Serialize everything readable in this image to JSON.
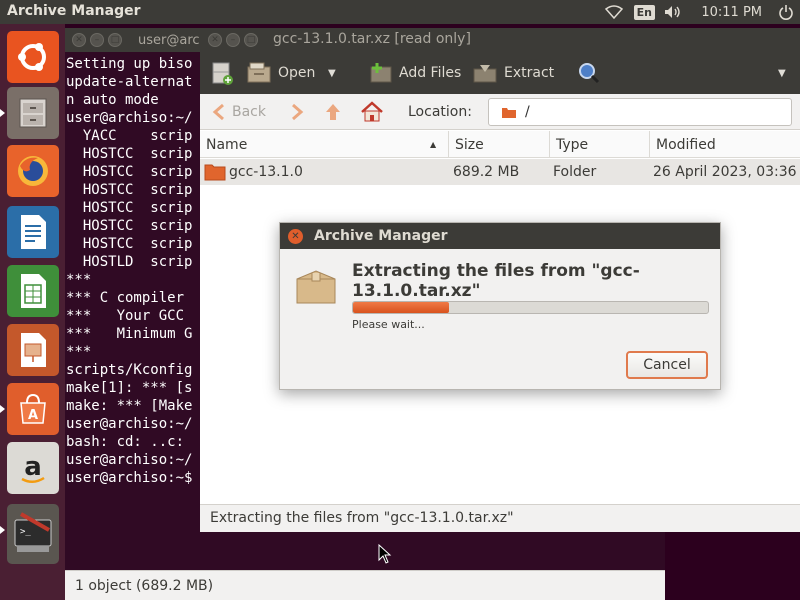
{
  "top_panel": {
    "app_title": "Archive Manager",
    "lang": "En",
    "clock": "10:11 PM",
    "icons": [
      "wifi-icon",
      "volume-icon",
      "power-icon"
    ]
  },
  "launcher": {
    "items": [
      "ubuntu-dash",
      "files",
      "firefox",
      "writer",
      "calc",
      "impress",
      "software-center",
      "amazon",
      "terminal"
    ]
  },
  "terminal": {
    "title": "user@archiso: ~",
    "title_visible": "user@arc",
    "lines": [
      "Setting up biso",
      "update-alternat",
      "n auto mode",
      "user@archiso:~/",
      "  YACC    scrip",
      "  HOSTCC  scrip",
      "  HOSTCC  scrip",
      "  HOSTCC  scrip",
      "  HOSTCC  scrip",
      "  HOSTCC  scrip",
      "  HOSTCC  scrip",
      "  HOSTLD  scrip",
      "***",
      "*** C compiler ",
      "***   Your GCC ",
      "***   Minimum G",
      "***",
      "scripts/Kconfig",
      "make[1]: *** [s",
      "make: *** [Make",
      "user@archiso:~/",
      "bash: cd: ..c: ",
      "user@archiso:~/",
      "user@archiso:~$"
    ],
    "status": "1 object (689.2 MB)"
  },
  "archive": {
    "title": "gcc-13.1.0.tar.xz [read only]",
    "toolbar": {
      "open": "Open",
      "add_files": "Add Files",
      "extract": "Extract"
    },
    "nav": {
      "back": "Back",
      "location_label": "Location:",
      "location_value": "/"
    },
    "columns": [
      "Name",
      "Size",
      "Type",
      "Modified"
    ],
    "rows": [
      {
        "name": "gcc-13.1.0",
        "size": "689.2 MB",
        "type": "Folder",
        "modified": "26 April 2023, 03:36"
      }
    ],
    "status": "Extracting the files from \"gcc-13.1.0.tar.xz\""
  },
  "dialog": {
    "title": "Archive Manager",
    "heading": "Extracting the files from \"gcc-13.1.0.tar.xz\"",
    "progress_fraction": 0.27,
    "wait_text": "Please wait...",
    "cancel_label": "Cancel"
  },
  "colors": {
    "panel": "#3c3b37",
    "terminal_bg": "#300a24",
    "accent": "#e05e2c",
    "folder": "#e0652d"
  }
}
